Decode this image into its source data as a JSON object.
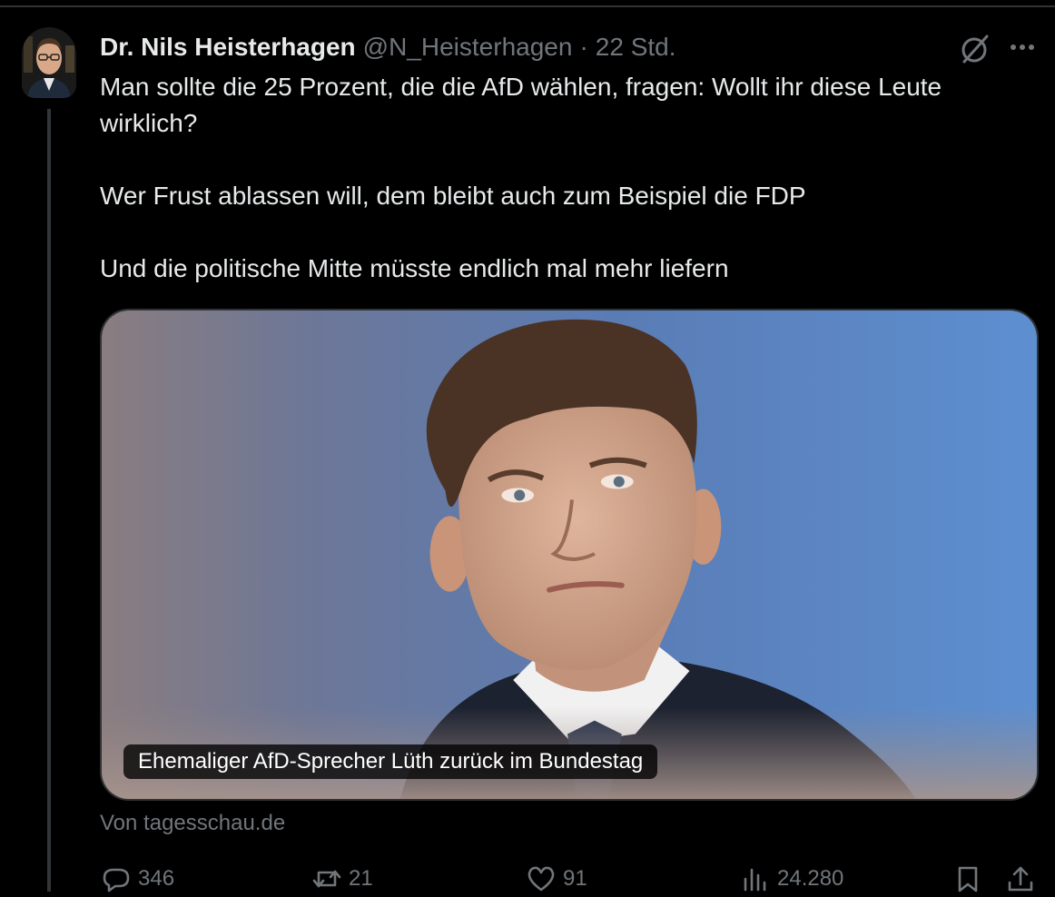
{
  "tweet": {
    "author_name": "Dr. Nils Heisterhagen",
    "handle": "@N_Heisterhagen",
    "separator": "·",
    "time": "22 Std.",
    "lines": [
      "Man sollte die 25 Prozent, die die AfD wählen, fragen: Wollt ihr diese Leute wirklich?",
      "Wer Frust ablassen will, dem bleibt auch zum Beispiel die FDP",
      "Und die politische Mitte müsste endlich mal mehr liefern"
    ]
  },
  "card": {
    "caption": "Ehemaliger AfD-Sprecher Lüth zurück im Bundestag",
    "source": "Von tagesschau.de"
  },
  "actions": {
    "replies": "346",
    "reposts": "21",
    "likes": "91",
    "views": "24.280"
  },
  "icons": {
    "reply": "reply-icon",
    "repost": "repost-icon",
    "like": "heart-icon",
    "views": "views-icon",
    "bookmark": "bookmark-icon",
    "share": "share-icon",
    "grok": "grok-icon",
    "more": "more-icon"
  },
  "colors": {
    "background": "#000000",
    "text": "#e7e9ea",
    "muted": "#71767b",
    "border": "#2f3336"
  }
}
